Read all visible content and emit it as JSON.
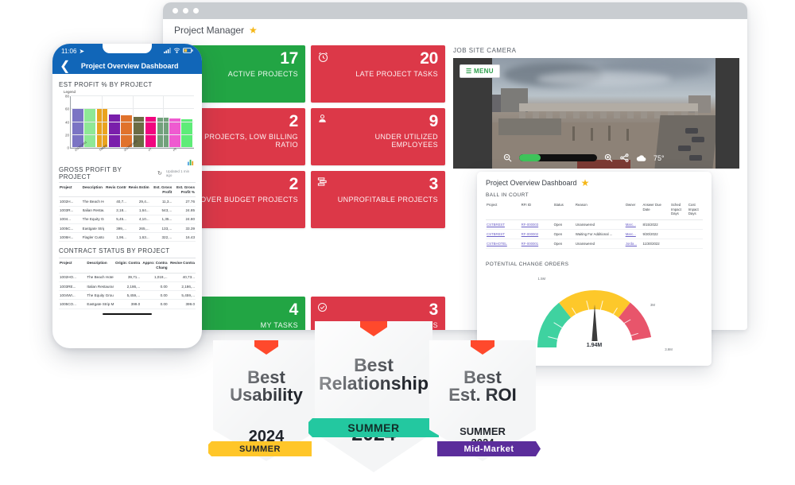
{
  "browser": {
    "title": "Project Manager",
    "star_icon": "star-icon"
  },
  "tiles": [
    {
      "value": "17",
      "label": "ACTIVE PROJECTS",
      "color": "green",
      "icon": "battery-icon"
    },
    {
      "value": "20",
      "label": "LATE PROJECT TASKS",
      "color": "red",
      "icon": "alarm-clock-icon"
    },
    {
      "value": "2",
      "label": "PROJECTS, LOW BILLING RATIO",
      "color": "red",
      "icon": "none"
    },
    {
      "value": "9",
      "label": "UNDER UTILIZED EMPLOYEES",
      "color": "red",
      "icon": "person-icon"
    },
    {
      "value": "2",
      "label": "OVER BUDGET PROJECTS",
      "color": "red",
      "icon": "none"
    },
    {
      "value": "3",
      "label": "UNPROFITABLE PROJECTS",
      "color": "red",
      "icon": "stack-icon"
    },
    {
      "value": "4",
      "label": "MY TASKS",
      "color": "green",
      "icon": "none"
    },
    {
      "value": "3",
      "label": "MY OVERDUE TASKS",
      "color": "red",
      "icon": "check-circle-icon"
    }
  ],
  "camera": {
    "title": "JOB SITE CAMERA",
    "menu_label": "MENU",
    "temperature": "75°",
    "zoom_out_icon": "zoom-out-icon",
    "zoom_in_icon": "zoom-in-icon",
    "share_icon": "share-icon",
    "weather_icon": "cloud-icon"
  },
  "phone": {
    "status_time": "11:06",
    "location_icon": "location-arrow-icon",
    "signal_icon": "signal-icon",
    "wifi_icon": "wifi-icon",
    "battery_icon": "battery-icon",
    "back_icon": "chevron-left-icon",
    "header_title": "Project Overview Dashboard",
    "chart_section_title": "EST PROFIT % BY PROJECT",
    "legend_label": "Legend",
    "gross_section_title": "GROSS PROFIT BY PROJECT",
    "refresh_icon": "refresh-icon",
    "updated_text": "Updated 1 min ago",
    "gross_table": {
      "columns": [
        "Project",
        "Description",
        "Revis Contr",
        "Revis Estim",
        "Est. Gross Profit",
        "Est. Gross Profit %"
      ],
      "rows": [
        [
          "1002H...",
          "The Beach Hot...",
          "40,7...",
          "29,4...",
          "11,3...",
          "27.76"
        ],
        [
          "1003R...",
          "Italian Restaura...",
          "2,18...",
          "1,64...",
          "543,...",
          "24.85"
        ],
        [
          "1004...",
          "The Equity Gro...",
          "5,45...",
          "4,10...",
          "1,35...",
          "24.80"
        ],
        [
          "1005C...",
          "Eastgate Strip ...",
          "399,...",
          "265,...",
          "133,...",
          "33.39"
        ],
        [
          "1006H...",
          "Flagler Custom ...",
          "1,96...",
          "1,63...",
          "322,...",
          "16.43"
        ]
      ]
    },
    "contract_section_title": "CONTRACT STATUS BY PROJECT",
    "contract_table": {
      "columns": [
        "Project",
        "Description",
        "Origin: Contra",
        "Appro: Contra Chang",
        "Revise Contra"
      ],
      "rows": [
        [
          "1002HO...",
          "The Beach Hotel a...",
          "39,71...",
          "1,019,...",
          "40,73..."
        ],
        [
          "1003RE...",
          "Italian Restaurant ...",
          "2,186,...",
          "0.00",
          "2,186,..."
        ],
        [
          "1004WI...",
          "The Equity Group -...",
          "5,459,...",
          "0.00",
          "5,459,..."
        ],
        [
          "1005CO...",
          "Eastgate Strip Mall",
          "399.0",
          "0.00",
          "399.0"
        ]
      ]
    }
  },
  "pod": {
    "title": "Project Overview Dashboard",
    "star_icon": "star-icon",
    "ball_in_court_title": "BALL IN COURT",
    "ball_table": {
      "columns": [
        "Project",
        "RFI ID",
        "Status",
        "Reason",
        "Owner",
        "Answer Due Date",
        "Sched Impact Days",
        "Cost Impact Days"
      ],
      "rows": [
        [
          "CSTBREST",
          "RF-000003",
          "Open",
          "Unanswered",
          "Marc...",
          "8/15/2022",
          "",
          ""
        ],
        [
          "CSTBREST",
          "RF-000002",
          "Open",
          "Waiting For Additional ...",
          "Marc...",
          "9/30/2022",
          "",
          ""
        ],
        [
          "CSTBHOTEL",
          "RF-000001",
          "Open",
          "Unanswered",
          "Jorda...",
          "11/30/2022",
          "",
          ""
        ]
      ]
    },
    "change_orders_title": "POTENTIAL CHANGE ORDERS"
  },
  "badges": [
    {
      "title_line1": "Best",
      "title_line2": "Usability",
      "ribbon": "SUMMER",
      "ribbon_color": "#ffc629",
      "ribbon_text_color": "#20242b",
      "year": "2024",
      "sub": "",
      "g2_icon": "g2-logo-icon"
    },
    {
      "title_line1": "Best",
      "title_line2": "Relationship",
      "ribbon": "SUMMER",
      "ribbon_color": "#23c8a0",
      "ribbon_text_color": "#1d2a28",
      "year": "2024",
      "sub": "",
      "g2_icon": "g2-logo-icon"
    },
    {
      "title_line1": "Best",
      "title_line2": "Est. ROI",
      "ribbon": "Mid-Market",
      "ribbon_color": "#5b2d9b",
      "ribbon_text_color": "#ffffff",
      "year": "2024",
      "sub": "SUMMER",
      "g2_icon": "g2-logo-icon"
    }
  ],
  "chart_data": [
    {
      "type": "bar",
      "title": "EST PROFIT % BY PROJECT",
      "categories": [
        "1017CUS01",
        "SBUREC02",
        "TIM003",
        "FLRSO906",
        "2017PRO003",
        "P6",
        "P7",
        "P8",
        "P9",
        "P10"
      ],
      "values": [
        61,
        60,
        60,
        52,
        50,
        48,
        48,
        47,
        45,
        44
      ],
      "colors": [
        "#7b74c4",
        "#8fe896",
        "#eaa31f",
        "#7a1fab",
        "#e0722c",
        "#6b6c44",
        "#f0067f",
        "#72a17c",
        "#ef5ad0",
        "#5eec78"
      ],
      "xlabel": "",
      "ylabel": "",
      "ylim": [
        0,
        80
      ],
      "yticks": [
        0,
        20,
        40,
        60,
        80
      ],
      "grid": true,
      "legend": "Legend"
    },
    {
      "type": "gauge",
      "title": "POTENTIAL CHANGE ORDERS",
      "value": 1.94,
      "value_label": "1.94M",
      "min": 0,
      "max": 3.9,
      "ticks": [
        "0",
        "1.5M",
        "3M",
        "3.9M"
      ],
      "bands": [
        {
          "from": 0,
          "to": 1.5,
          "color": "#3fd2a0"
        },
        {
          "from": 1.5,
          "to": 3.0,
          "color": "#fdc82a"
        },
        {
          "from": 3.0,
          "to": 3.9,
          "color": "#e8556b"
        }
      ]
    }
  ]
}
